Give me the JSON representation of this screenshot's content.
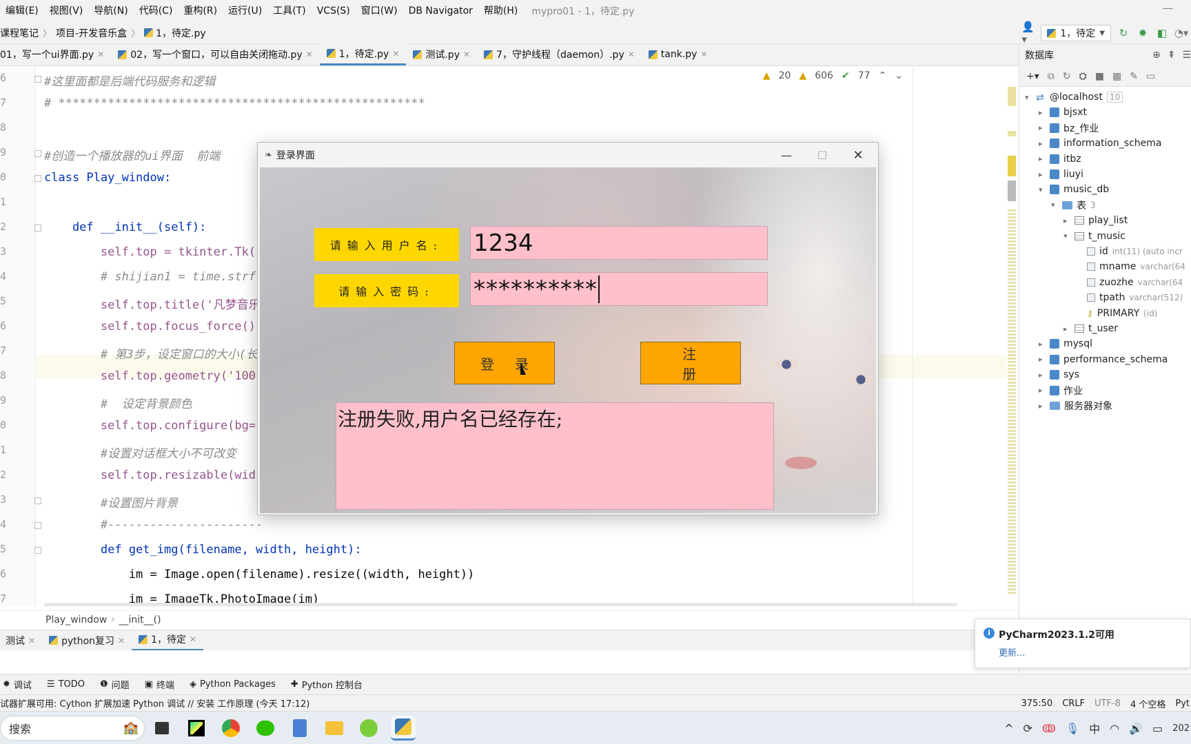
{
  "menu": {
    "items": [
      "编辑(E)",
      "视图(V)",
      "导航(N)",
      "代码(C)",
      "重构(R)",
      "运行(U)",
      "工具(T)",
      "VCS(S)",
      "窗口(W)",
      "DB Navigator",
      "帮助(H)"
    ],
    "window_title": "mypro01 - 1，待定.py",
    "minimize": "—"
  },
  "nav": {
    "crumbs": [
      "课程笔记",
      "项目-开发音乐盒",
      "1，待定.py"
    ],
    "run_config": "1，待定"
  },
  "tabs": [
    {
      "label": "01，写一个ui界面.py"
    },
    {
      "label": "02，写一个窗口，可以自由关闭拖动.py"
    },
    {
      "label": "1，待定.py"
    },
    {
      "label": "测试.py"
    },
    {
      "label": "7，守护线程（daemon）.py"
    },
    {
      "label": "tank.py"
    }
  ],
  "inspections": {
    "warnings_weak": "20",
    "warnings": "606",
    "ok": "77"
  },
  "editor": {
    "line_numbers": [
      "6",
      "7",
      "8",
      "9",
      "0",
      "1",
      "2",
      "3",
      "4",
      "5",
      "6",
      "7",
      "8",
      "9",
      "0",
      "1",
      "2",
      "3",
      "4",
      "5",
      "6",
      "7"
    ],
    "lines": [
      {
        "t": "#这里面都是后端代码服务和逻辑",
        "c": "cm"
      },
      {
        "t": "# ****************************************************",
        "c": "cm"
      },
      {
        "t": "",
        "c": ""
      },
      {
        "t": "#创造一个播放器的ui界面  前端",
        "c": "cm"
      },
      {
        "t": "class Play_window:",
        "c": "kwline"
      },
      {
        "t": "",
        "c": ""
      },
      {
        "t": "    def __init__(self):",
        "c": "def"
      },
      {
        "t": "        self.top = tkinter.Tk(",
        "c": "self"
      },
      {
        "t": "        # shijian1 = time.strf",
        "c": "cm"
      },
      {
        "t": "        self.top.title('凡梦音乐",
        "c": "self"
      },
      {
        "t": "        self.top.focus_force()",
        "c": "self"
      },
      {
        "t": "        # 第3步，设定窗口的大小(长",
        "c": "cm"
      },
      {
        "t": "        self.top.geometry('100",
        "c": "self"
      },
      {
        "t": "        #  设定背景颜色",
        "c": "cm"
      },
      {
        "t": "        self.top.configure(bg=",
        "c": "self"
      },
      {
        "t": "        #设置对话框大小不可改变",
        "c": "cm"
      },
      {
        "t": "        self.top.resizable(wid",
        "c": "self"
      },
      {
        "t": "        #设置图片背景",
        "c": "cm"
      },
      {
        "t": "        #----------------------",
        "c": "cm"
      },
      {
        "t": "        def get_img(filename, width, height):",
        "c": "def"
      },
      {
        "t": "            im = Image.open(filename).resize((width, height))",
        "c": ""
      },
      {
        "t": "            im = ImageTk.PhotoImage(im)",
        "c": ""
      }
    ]
  },
  "code_breadcrumb": [
    "Play_window",
    "__init__()"
  ],
  "run_tabs": [
    {
      "label": "测试"
    },
    {
      "label": "python复习"
    },
    {
      "label": "1，待定"
    }
  ],
  "tool_windows": [
    "调试",
    "TODO",
    "问题",
    "终端",
    "Python Packages",
    "Python 控制台"
  ],
  "status": {
    "message": "试器扩展可用: Cython 扩展加速 Python 调试 // 安装   工作原理 (今天 17:12)",
    "position": "375:50",
    "line_sep": "CRLF",
    "encoding": "UTF-8",
    "indent": "4 个空格",
    "interpreter": "Pyt"
  },
  "taskbar": {
    "search_placeholder": "搜索",
    "ime": "中",
    "clock": "202"
  },
  "db": {
    "title": "数据库",
    "tree": [
      {
        "label": "@localhost",
        "badge": "10",
        "depth": 0,
        "arrow": "▾",
        "icon": "server"
      },
      {
        "label": "bjsxt",
        "depth": 1,
        "arrow": "▸",
        "icon": "db"
      },
      {
        "label": "bz_作业",
        "depth": 1,
        "arrow": "▸",
        "icon": "db"
      },
      {
        "label": "information_schema",
        "depth": 1,
        "arrow": "▸",
        "icon": "db"
      },
      {
        "label": "itbz",
        "depth": 1,
        "arrow": "▸",
        "icon": "db"
      },
      {
        "label": "liuyi",
        "depth": 1,
        "arrow": "▸",
        "icon": "db"
      },
      {
        "label": "music_db",
        "depth": 1,
        "arrow": "▾",
        "icon": "db"
      },
      {
        "label": "表",
        "badge": "3",
        "depth": 2,
        "arrow": "▾",
        "icon": "folder"
      },
      {
        "label": "play_list",
        "depth": 3,
        "arrow": "▸",
        "icon": "table"
      },
      {
        "label": "t_music",
        "depth": 3,
        "arrow": "▾",
        "icon": "table"
      },
      {
        "label": "id",
        "type": "int(11) (auto incr",
        "depth": 4,
        "arrow": "",
        "icon": "col"
      },
      {
        "label": "mname",
        "type": "varchar(64",
        "depth": 4,
        "arrow": "",
        "icon": "col"
      },
      {
        "label": "zuozhe",
        "type": "varchar(64",
        "depth": 4,
        "arrow": "",
        "icon": "col"
      },
      {
        "label": "tpath",
        "type": "varchar(512)",
        "depth": 4,
        "arrow": "",
        "icon": "col"
      },
      {
        "label": "PRIMARY",
        "type": "(id)",
        "depth": 4,
        "arrow": "",
        "icon": "key"
      },
      {
        "label": "t_user",
        "depth": 3,
        "arrow": "▸",
        "icon": "table"
      },
      {
        "label": "mysql",
        "depth": 1,
        "arrow": "▸",
        "icon": "db"
      },
      {
        "label": "performance_schema",
        "depth": 1,
        "arrow": "▸",
        "icon": "db"
      },
      {
        "label": "sys",
        "depth": 1,
        "arrow": "▸",
        "icon": "db"
      },
      {
        "label": "作业",
        "depth": 1,
        "arrow": "▸",
        "icon": "db"
      },
      {
        "label": "服务器对象",
        "depth": 1,
        "arrow": "▸",
        "icon": "folder"
      }
    ]
  },
  "notification": {
    "title": "PyCharm2023.1.2可用",
    "link": "更新..."
  },
  "dialog": {
    "title": "登录界面",
    "username_label": "请输入用户名:",
    "password_label": "请输入密码:",
    "username_value": "1234",
    "password_value": "**********",
    "login_button": "登录",
    "register_button": "注册",
    "message": "注册失败,用户名已经存在;",
    "colors": {
      "label_bg": "#ffd700",
      "entry_bg": "#ffc0cb",
      "button_bg": "#ffa500"
    }
  }
}
